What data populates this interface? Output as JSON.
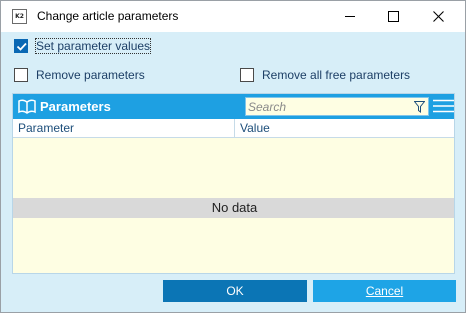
{
  "window": {
    "title": "Change article parameters",
    "icon_text": "K2",
    "controls": [
      "minimize-icon",
      "maximize-icon",
      "close-icon"
    ]
  },
  "options": {
    "set_values": {
      "label": "Set parameter values",
      "checked": true
    },
    "remove_parameters": {
      "label": "Remove parameters",
      "checked": false
    },
    "remove_all_free": {
      "label": "Remove all free parameters",
      "checked": false
    }
  },
  "panel": {
    "title": "Parameters",
    "search_placeholder": "Search",
    "columns": [
      "Parameter",
      "Value"
    ],
    "empty_text": "No data"
  },
  "buttons": {
    "ok": "OK",
    "cancel": "Cancel"
  },
  "colors": {
    "accent": "#1ea0e2",
    "ok_button": "#0b75b5",
    "cancel_button": "#1ea4e6",
    "dialog_background": "#d7eef8",
    "grid_background": "#fefee3"
  }
}
